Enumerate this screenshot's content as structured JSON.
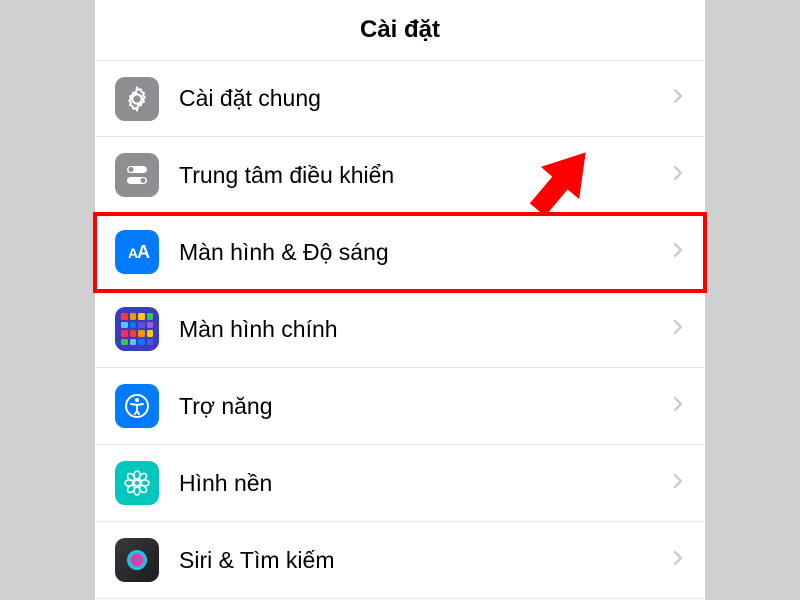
{
  "header": {
    "title": "Cài đặt"
  },
  "rows": [
    {
      "label": "Cài đặt chung"
    },
    {
      "label": "Trung tâm điều khiển"
    },
    {
      "label": "Màn hình & Độ sáng"
    },
    {
      "label": "Màn hình chính"
    },
    {
      "label": "Trợ năng"
    },
    {
      "label": "Hình nền"
    },
    {
      "label": "Siri & Tìm kiếm"
    }
  ],
  "annotation": {
    "arrow_color": "#ff0000",
    "highlight_index": 2
  }
}
